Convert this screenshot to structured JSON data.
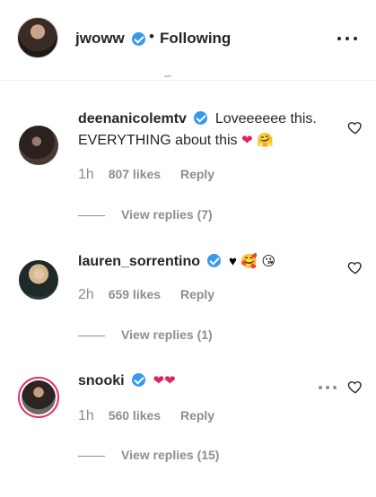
{
  "header": {
    "username": "jwoww",
    "separator": "•",
    "follow_label": "Following",
    "more_icon": "more-horizontal-icon"
  },
  "comments": [
    {
      "username": "deenanicolemtv",
      "text": "Loveeeeee this. EVERYTHING about this",
      "emojis": [
        "red-heart",
        "hugging-face"
      ],
      "time": "1h",
      "likes": "807 likes",
      "reply_label": "Reply",
      "view_replies": "View replies (7)"
    },
    {
      "username": "lauren_sorrentino",
      "text": "",
      "emojis": [
        "black-heart",
        "smiling-face-with-hearts",
        "face-blowing-kiss"
      ],
      "time": "2h",
      "likes": "659 likes",
      "reply_label": "Reply",
      "view_replies": "View replies (1)"
    },
    {
      "username": "snooki",
      "text": "",
      "emojis": [
        "red-heart",
        "red-heart"
      ],
      "time": "1h",
      "likes": "560 likes",
      "reply_label": "Reply",
      "view_replies": "View replies (15)"
    }
  ],
  "colors": {
    "verified": "#3897f0",
    "secondary_text": "#8e8e8e",
    "primary_text": "#262626",
    "story_ring": "#e1306c"
  }
}
